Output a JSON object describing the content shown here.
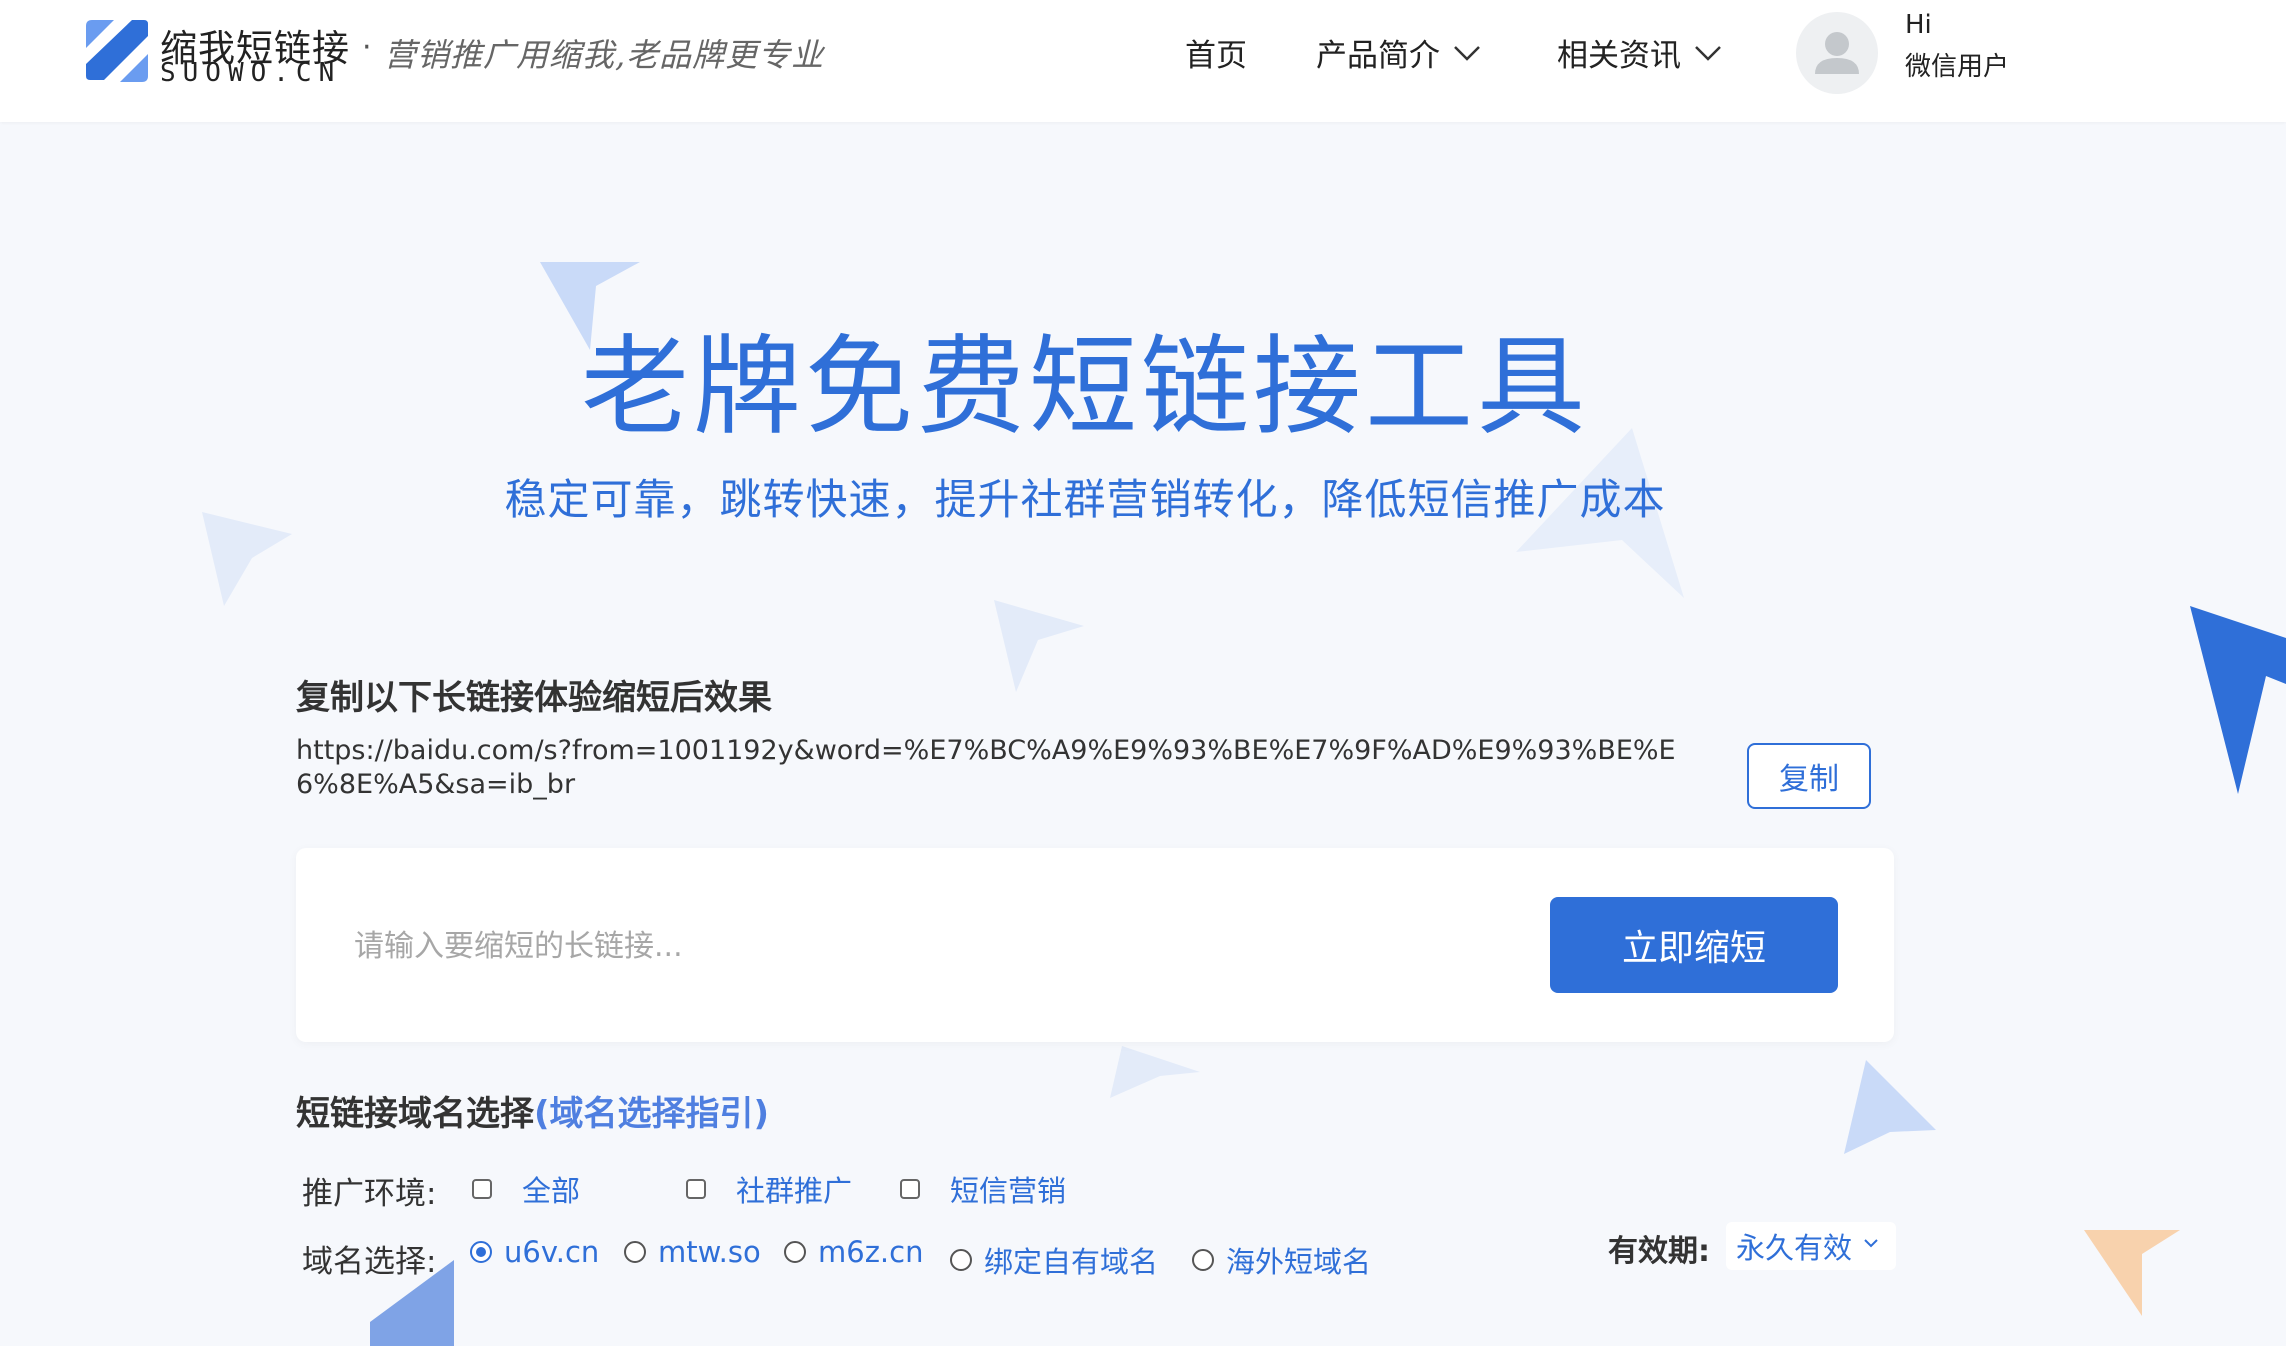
{
  "brand": {
    "name": "缩我短链接",
    "domain": "SUOWO.CN",
    "separator": "·",
    "slogan": "营销推广用缩我,老品牌更专业"
  },
  "nav": {
    "home": "首页",
    "products": "产品简介",
    "news": "相关资讯"
  },
  "user": {
    "greeting": "Hi",
    "name": "微信用户"
  },
  "hero": {
    "title": "老牌免费短链接工具",
    "subtitle": "稳定可靠，跳转快速，提升社群营销转化，降低短信推广成本"
  },
  "demo": {
    "heading": "复制以下长链接体验缩短后效果",
    "url": "https://baidu.com/s?from=1001192y&word=%E7%BC%A9%E9%93%BE%E7%9F%AD%E9%93%BE%E6%8E%A5&sa=ib_br",
    "copy_label": "复制"
  },
  "shorten": {
    "placeholder": "请输入要缩短的长链接...",
    "button_label": "立即缩短"
  },
  "domain_section": {
    "heading": "短链接域名选择",
    "guide_link": "(域名选择指引)",
    "env_label": "推广环境:",
    "env_options": [
      "全部",
      "社群推广",
      "短信营销"
    ],
    "domain_label": "域名选择:",
    "domain_options": [
      "u6v.cn",
      "mtw.so",
      "m6z.cn",
      "绑定自有域名",
      "海外短域名"
    ],
    "domain_selected": "u6v.cn"
  },
  "validity": {
    "label": "有效期:",
    "value": "永久有效"
  },
  "colors": {
    "primary": "#2f6fd8",
    "background": "#f6f8fc",
    "header_bg": "#ffffff",
    "deco_light": "#c9daf8",
    "deco_orange": "#f8d2ad"
  }
}
